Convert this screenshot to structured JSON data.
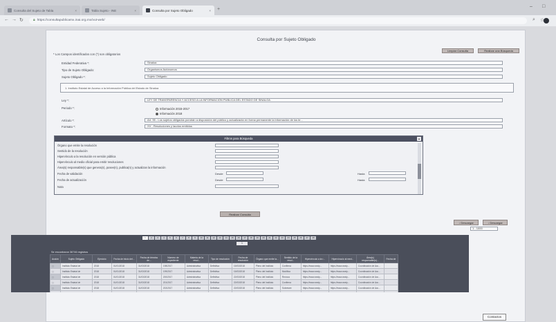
{
  "browser": {
    "tabs": [
      {
        "title": "Consulta del Sujeto de Tabla",
        "active": false
      },
      {
        "title": "Tabla Sujeto - INE",
        "active": false
      },
      {
        "title": "Consulta por Sujeto Obligado",
        "active": true
      }
    ],
    "url": "https://consultapublicamx.inai.org.mx/vut-web/"
  },
  "page": {
    "title": "Consulta por Sujeto Obligado",
    "required_note": "* Los Campos identificados con (*) son obligatorios",
    "clear_button": "Limpiar Consulta",
    "new_search_button": "Realizar una Búsqueda"
  },
  "form": {
    "entidad_label": "Entidad Federativa *:",
    "entidad_value": "Sinaloa",
    "tipo_label": "Tipo de Sujeto Obligado:",
    "tipo_value": "Organismos Autónomos",
    "sujeto_label": "Sujeto Obligado *:",
    "sujeto_value": "Sujeto Obligado",
    "selected_note": "1. Instituto Estatal de Acceso a la Información Pública del Estado de Sinaloa",
    "ley_label": "Ley *:",
    "ley_value": "LEY DE TRANSPARENCIA Y ACCESO A LA INFORMACIÓN PÚBLICA DEL ESTADO DE SINALOA",
    "periodo_label": "Periodo *:",
    "periodo_opt1": "Información 2015-2017",
    "periodo_opt2": "Información 2018",
    "articulo_label": "Artículo *:",
    "articulo_value": "Art. 95 - Los sujetos obligados pondrán a disposición del público y actualizarán en forma permanente la información de los te...",
    "formato_label": "Formato *:",
    "formato_value": "XV - Resoluciones y laudos emitidos"
  },
  "filters": {
    "header": "Filtros para Búsqueda",
    "fields": [
      "Órgano que emite la resolución",
      "Sentido de la resolución",
      "Hipervínculo a la resolución en versión pública",
      "Hipervínculo al medio oficial para emitir resoluciones",
      "Área(s) responsable(s) que genera(n), posee(n), publica(n) y actualizan la información",
      "Fecha de validación",
      "Fecha de actualización",
      "Nota"
    ],
    "desde": "Desde",
    "hasta": "Hasta"
  },
  "actions": {
    "search_button": "Realizar Consulta",
    "download_left": "Descargar",
    "download_right": "Descargar",
    "page_size": "1 - 1000"
  },
  "results": {
    "pages": [
      "1",
      "2",
      "3",
      "4",
      "5",
      "6",
      "7",
      "8",
      "9",
      "10",
      "11",
      "12",
      "13",
      "14",
      "15",
      "16",
      "17",
      "18",
      "19",
      "20",
      "21",
      "22",
      "23",
      "24",
      "25",
      "26",
      "27",
      "28"
    ],
    "current_page": "1",
    "found_text": "Se encontraron 36746 registros",
    "columns": [
      "Acción",
      "Sujeto Obligado",
      "Ejercicio",
      "Fecha de inicio del...",
      "Fecha de término de...",
      "Número de expediente",
      "Materia de la resol...",
      "Tipo de resolución",
      "Fecha de resolución",
      "Órgano que emite la...",
      "Sentido de la resol...",
      "Hipervínculo a la r...",
      "Hipervínculo al med...",
      "Área(s) responsable(s)...",
      "Fecha de"
    ],
    "rows": [
      [
        "",
        "Instituto Estatal de",
        "2018",
        "01/01/2018",
        "31/03/2018",
        "198/2017",
        "Administrativa",
        "Definitiva",
        "15/03/2018",
        "Pleno del Instituto",
        "Confirma",
        "https://www.ceaip...",
        "https://www.ceaip...",
        "Coordinación de Acc...",
        ""
      ],
      [
        "",
        "Instituto Estatal de",
        "2018",
        "01/01/2018",
        "31/03/2018",
        "199/2017",
        "Administrativa",
        "Definitiva",
        "15/03/2018",
        "Pleno del Instituto",
        "Modifica",
        "https://www.ceaip...",
        "https://www.ceaip...",
        "Coordinación de Acc...",
        ""
      ],
      [
        "",
        "Instituto Estatal de",
        "2018",
        "01/01/2018",
        "31/03/2018",
        "200/2017",
        "Administrativa",
        "Definitiva",
        "22/03/2018",
        "Pleno del Instituto",
        "Revoca",
        "https://www.ceaip...",
        "https://www.ceaip...",
        "Coordinación de Acc...",
        ""
      ],
      [
        "",
        "Instituto Estatal de",
        "2018",
        "01/01/2018",
        "31/03/2018",
        "201/2017",
        "Administrativa",
        "Definitiva",
        "22/03/2018",
        "Pleno del Instituto",
        "Confirma",
        "https://www.ceaip...",
        "https://www.ceaip...",
        "Coordinación de Acc...",
        ""
      ],
      [
        "",
        "Instituto Estatal de",
        "2018",
        "01/01/2018",
        "31/03/2018",
        "202/2017",
        "Administrativa",
        "Definitiva",
        "22/03/2018",
        "Pleno del Instituto",
        "Sobresee",
        "https://www.ceaip...",
        "https://www.ceaip...",
        "Coordinación de Acc...",
        ""
      ],
      [
        "",
        "Instituto Estatal de",
        "2018",
        "01/01/2018",
        "31/03/2018",
        "203/2017",
        "Administrativa",
        "Definitiva",
        "29/03/2018",
        "Pleno del Instituto",
        "Revoca",
        "https://www.ceaip...",
        "https://www.ceaip...",
        "Coordinación de Acc...",
        ""
      ],
      [
        "",
        "Instituto Estatal de",
        "2018",
        "01/01/2018",
        "31/03/2018",
        "204/2017",
        "Administrativa",
        "Definitiva",
        "29/03/2018",
        "Pleno del Instituto",
        "Modifica",
        "https://www.ceaip...",
        "https://www.ceaip...",
        "Coordinación de Acc...",
        ""
      ]
    ]
  },
  "footer": {
    "chip": "Contactos"
  }
}
